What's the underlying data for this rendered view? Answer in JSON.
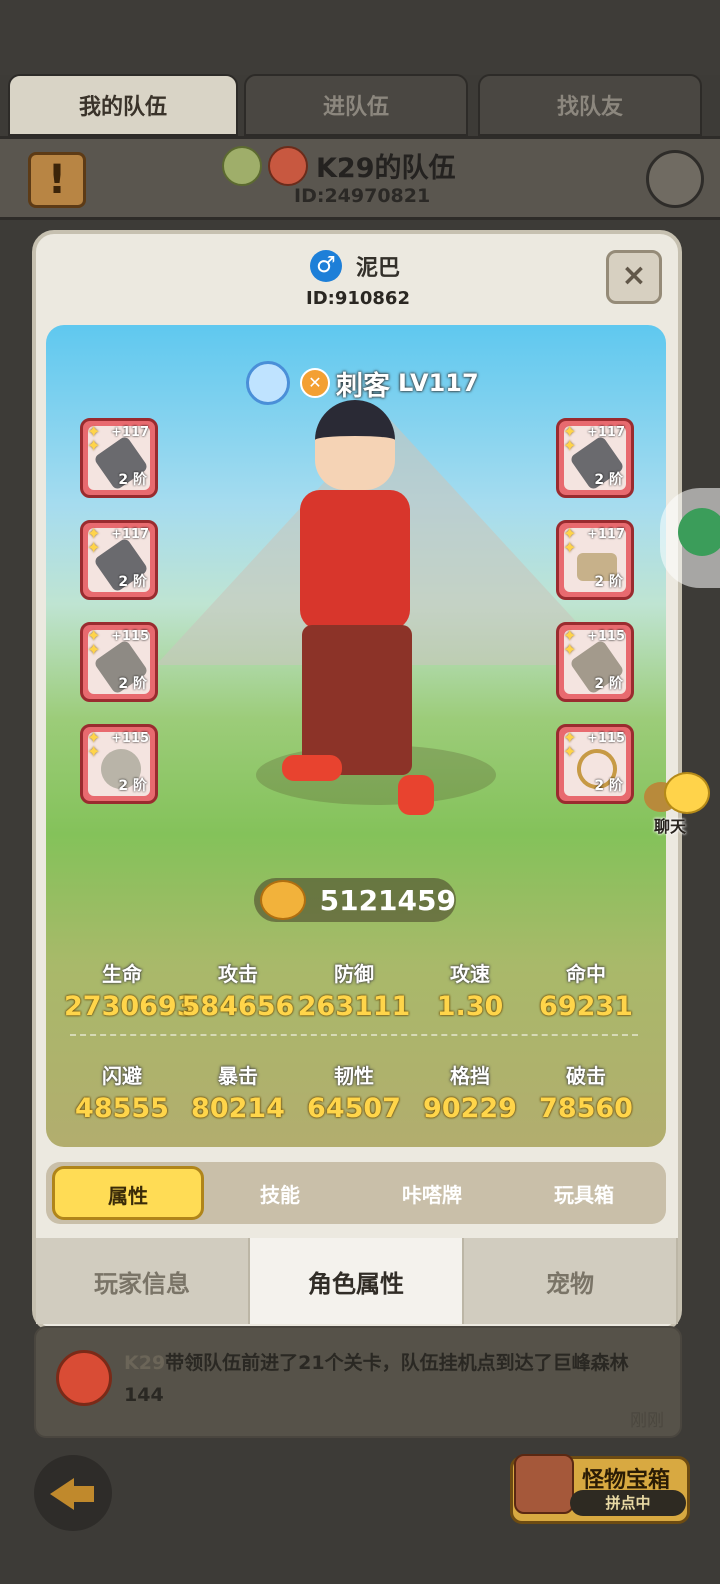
{
  "top_tabs": [
    {
      "label": "我的队伍",
      "active": true
    },
    {
      "label": "进队伍",
      "active": false
    },
    {
      "label": "找队友",
      "active": false
    }
  ],
  "team": {
    "name": "K29的队伍",
    "id": "ID:24970821"
  },
  "character": {
    "name": "泥巴",
    "id": "ID:910862",
    "class_name": "刺客",
    "level": "LV117",
    "power": "5121459"
  },
  "equipment_left": [
    {
      "level": "+117",
      "tier": "2 阶",
      "icon": "dagger-icon"
    },
    {
      "level": "+117",
      "tier": "2 阶",
      "icon": "blade-icon"
    },
    {
      "level": "+115",
      "tier": "2 阶",
      "icon": "boot-icon"
    },
    {
      "level": "+115",
      "tier": "2 阶",
      "icon": "ring-icon"
    }
  ],
  "equipment_right": [
    {
      "level": "+117",
      "tier": "2 阶",
      "icon": "dagger-icon"
    },
    {
      "level": "+117",
      "tier": "2 阶",
      "icon": "belt-icon"
    },
    {
      "level": "+115",
      "tier": "2 阶",
      "icon": "gauntlet-icon"
    },
    {
      "level": "+115",
      "tier": "2 阶",
      "icon": "necklace-icon"
    }
  ],
  "stats_row1": [
    {
      "label": "生命",
      "value": "2730693"
    },
    {
      "label": "攻击",
      "value": "584656"
    },
    {
      "label": "防御",
      "value": "263111"
    },
    {
      "label": "攻速",
      "value": "1.30"
    },
    {
      "label": "命中",
      "value": "69231"
    }
  ],
  "stats_row2": [
    {
      "label": "闪避",
      "value": "48555"
    },
    {
      "label": "暴击",
      "value": "80214"
    },
    {
      "label": "韧性",
      "value": "64507"
    },
    {
      "label": "格挡",
      "value": "90229"
    },
    {
      "label": "破击",
      "value": "78560"
    }
  ],
  "sub_tabs": [
    "属性",
    "技能",
    "咔嗒牌",
    "玩具箱"
  ],
  "bottom_tabs": [
    "玩家信息",
    "角色属性",
    "宠物"
  ],
  "chat": {
    "name": "K29",
    "message": "带领队伍前进了21个关卡，队伍挂机点到达了巨峰森林144",
    "time": "刚刚"
  },
  "chest": {
    "title": "怪物宝箱",
    "subtitle": "拼点中"
  },
  "side_chat_label": "聊天",
  "close_label": "×",
  "alert_label": "!",
  "gender_symbol": "♂"
}
